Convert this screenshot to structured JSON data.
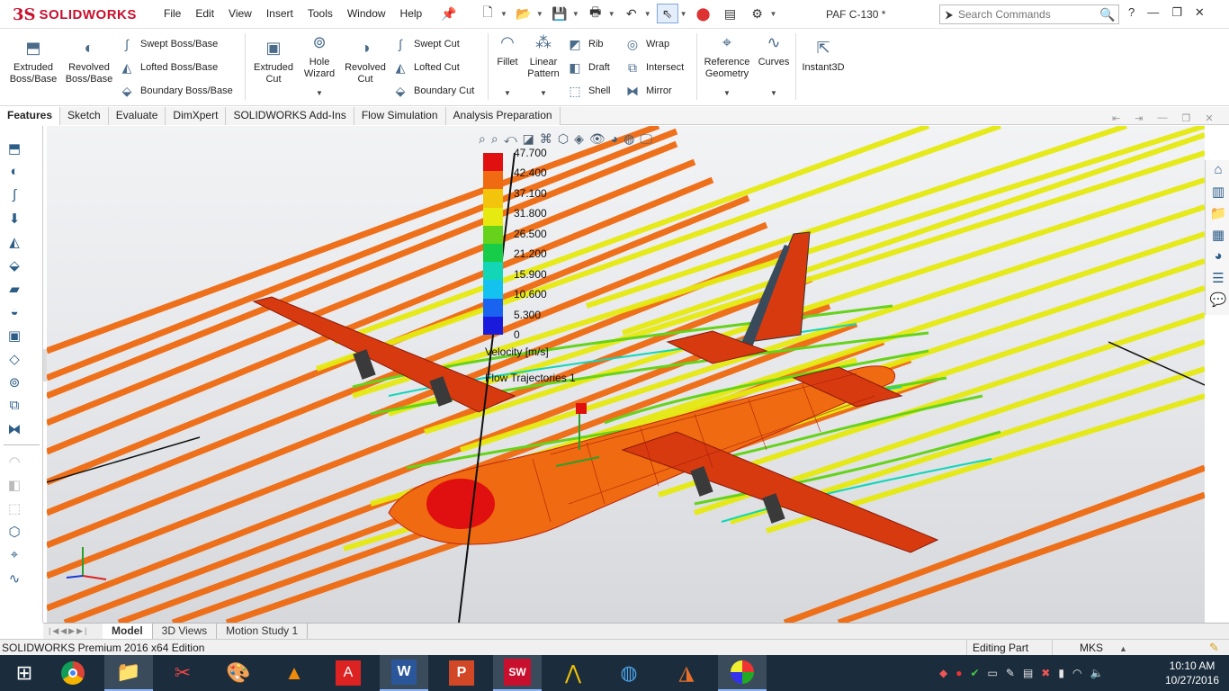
{
  "app": {
    "logo_mark": "3S",
    "logo_text": "SOLIDWORKS",
    "document_title": "PAF C-130 *"
  },
  "menu": [
    "File",
    "Edit",
    "View",
    "Insert",
    "Tools",
    "Window",
    "Help"
  ],
  "search": {
    "placeholder": "Search Commands"
  },
  "ribbon": {
    "extruded_boss": "Extruded\nBoss/Base",
    "revolved_boss": "Revolved\nBoss/Base",
    "swept_boss": "Swept Boss/Base",
    "lofted_boss": "Lofted Boss/Base",
    "boundary_boss": "Boundary Boss/Base",
    "extruded_cut": "Extruded\nCut",
    "hole_wizard": "Hole\nWizard",
    "revolved_cut": "Revolved\nCut",
    "swept_cut": "Swept Cut",
    "lofted_cut": "Lofted Cut",
    "boundary_cut": "Boundary Cut",
    "fillet": "Fillet",
    "linear_pattern": "Linear\nPattern",
    "rib": "Rib",
    "draft": "Draft",
    "shell": "Shell",
    "wrap": "Wrap",
    "intersect": "Intersect",
    "mirror": "Mirror",
    "reference_geometry": "Reference\nGeometry",
    "curves": "Curves",
    "instant3d": "Instant3D"
  },
  "tabs": [
    "Features",
    "Sketch",
    "Evaluate",
    "DimXpert",
    "SOLIDWORKS Add-Ins",
    "Flow Simulation",
    "Analysis Preparation"
  ],
  "legend": {
    "ticks": [
      "47.700",
      "42.400",
      "37.100",
      "31.800",
      "26.500",
      "21.200",
      "15.900",
      "10.600",
      "5.300",
      "0"
    ],
    "colors": [
      "#e01010",
      "#ef6a10",
      "#f2c40c",
      "#e6ea10",
      "#66d21a",
      "#16cc48",
      "#12d6b6",
      "#14c2f0",
      "#1a62f0",
      "#1a1adc"
    ],
    "unit": "Velocity [m/s]",
    "trajectories": "Flow Trajectories 1"
  },
  "model_tabs": [
    "Model",
    "3D Views",
    "Motion Study 1"
  ],
  "status": {
    "edition": "SOLIDWORKS Premium 2016 x64 Edition",
    "mode": "Editing Part",
    "units": "MKS"
  },
  "clock": {
    "time": "10:10 AM",
    "date": "10/27/2016"
  },
  "colors": {
    "brand": "#c8102e",
    "taskbar": "#1b2d3d",
    "stream_orange": "#ef6a10",
    "stream_yellow": "#e6ea10"
  },
  "icons": {
    "windows_start": "windows-logo-icon",
    "taskbar_apps": [
      "chrome-icon",
      "file-explorer-icon",
      "snipping-tool-icon",
      "paint-icon",
      "vlc-icon",
      "acrobat-icon",
      "word-icon",
      "powerpoint-icon",
      "solidworks-2016-icon",
      "autodesk-icon",
      "network-globe-icon",
      "matlab-icon",
      "color-balls-icon"
    ]
  }
}
